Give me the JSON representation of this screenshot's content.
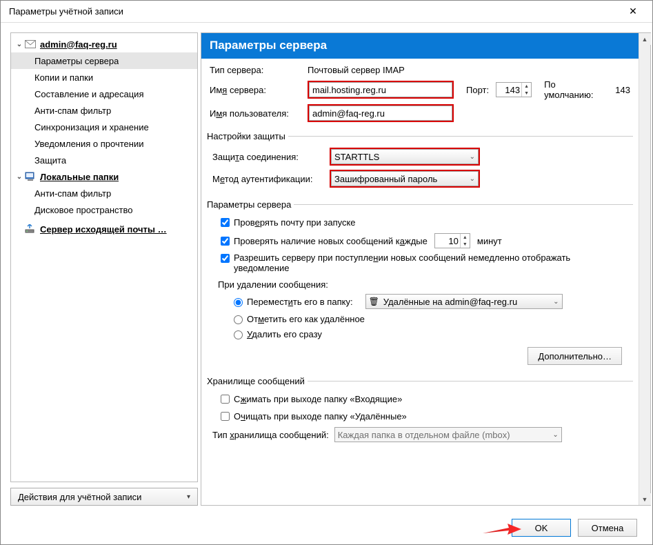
{
  "window": {
    "title": "Параметры учётной записи"
  },
  "sidebar": {
    "account": {
      "label": "admin@faq-reg.ru",
      "items": [
        {
          "label": "Параметры сервера",
          "selected": true
        },
        {
          "label": "Копии и папки"
        },
        {
          "label": "Составление и адресация"
        },
        {
          "label": "Анти-спам фильтр"
        },
        {
          "label": "Синхронизация и хранение"
        },
        {
          "label": "Уведомления о прочтении"
        },
        {
          "label": "Защита"
        }
      ]
    },
    "local": {
      "label": "Локальные папки",
      "items": [
        {
          "label": "Анти-спам фильтр"
        },
        {
          "label": "Дисковое пространство"
        }
      ]
    },
    "outgoing": {
      "label": "Сервер исходящей почты …"
    },
    "actions_button": "Действия для учётной записи"
  },
  "header": {
    "title": "Параметры сервера"
  },
  "server": {
    "type_label": "Тип сервера:",
    "type_value": "Почтовый сервер IMAP",
    "name_label": "Имя сервера:",
    "name_value": "mail.hosting.reg.ru",
    "port_label": "Порт:",
    "port_value": "143",
    "default_port_label": "По умолчанию:",
    "default_port_value": "143",
    "user_label": "Имя пользователя:",
    "user_value": "admin@faq-reg.ru"
  },
  "security": {
    "group_label": "Настройки защиты",
    "connection_label": "Защита соединения:",
    "connection_value": "STARTTLS",
    "auth_label": "Метод аутентификации:",
    "auth_value": "Зашифрованный пароль"
  },
  "server_options": {
    "group_label": "Параметры сервера",
    "check_startup": "Проверять почту при запуске",
    "check_interval_prefix": "Проверять наличие новых сообщений каждые",
    "check_interval_value": "10",
    "check_interval_suffix": "минут",
    "instant_notify": "Разрешить серверу при поступлении новых сообщений немедленно отображать уведомление",
    "on_delete_label": "При удалении сообщения:",
    "move_label": "Переместить его в папку:",
    "move_target": "Удалённые на admin@faq-reg.ru",
    "mark_deleted": "Отметить его как удалённое",
    "delete_now": "Удалить его сразу",
    "advanced_button": "Дополнительно…"
  },
  "storage": {
    "group_label": "Хранилище сообщений",
    "compact_on_exit": "Сжимать при выходе папку «Входящие»",
    "empty_trash_on_exit": "Очищать при выходе папку «Удалённые»",
    "store_type_label": "Тип хранилища сообщений:",
    "store_type_value": "Каждая папка в отдельном файле (mbox)"
  },
  "footer": {
    "ok": "OK",
    "cancel": "Отмена"
  }
}
